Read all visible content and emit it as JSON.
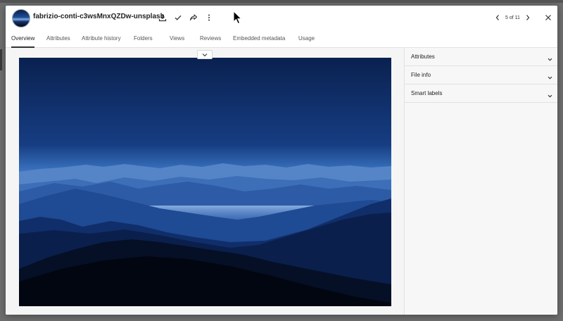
{
  "asset": {
    "title": "fabrizio-conti-c3wsMnxQZDw-unsplash"
  },
  "header": {
    "actions": [
      {
        "name": "download-icon"
      },
      {
        "name": "checkmark-icon"
      },
      {
        "name": "share-icon"
      },
      {
        "name": "more-vertical-icon"
      }
    ],
    "pager": {
      "text": "5 of 11"
    }
  },
  "tabs": [
    {
      "label": "Overview",
      "active": true
    },
    {
      "label": "Attributes",
      "active": false
    },
    {
      "label": "Attribute history",
      "active": false
    },
    {
      "label": "Folders",
      "active": false
    },
    {
      "label": "Views",
      "active": false
    },
    {
      "label": "Reviews",
      "active": false
    },
    {
      "label": "Embedded metadata",
      "active": false
    },
    {
      "label": "Usage",
      "active": false
    }
  ],
  "side_panels": [
    {
      "label": "Attributes"
    },
    {
      "label": "File info"
    },
    {
      "label": "Smart labels"
    }
  ],
  "colors": {
    "sky_top": "#0b2556",
    "sky_bottom": "#2e6bc0",
    "haze": "#a9c6ea",
    "foreground": "#030814",
    "tab_active_underline": "#333333"
  }
}
